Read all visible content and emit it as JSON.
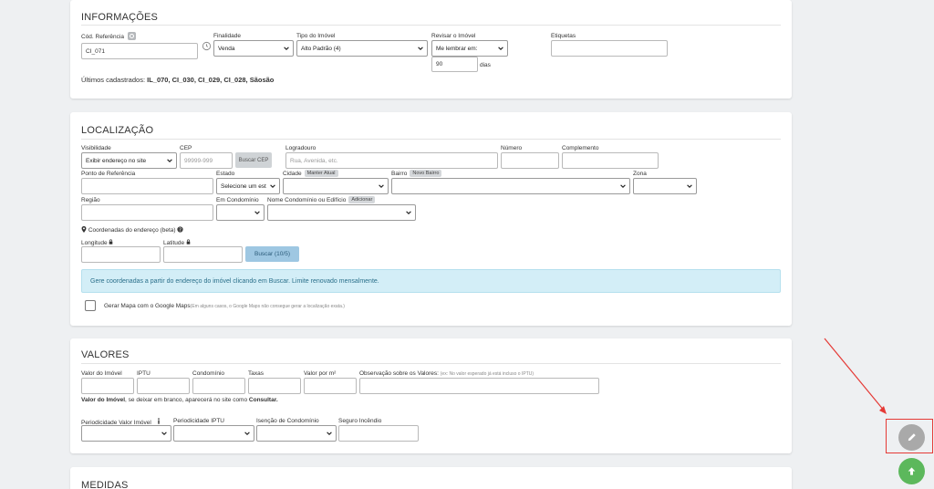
{
  "informacoes": {
    "title": "INFORMAÇÕES",
    "cod_label": "Cód. Referência",
    "cod_value": "CI_071",
    "finalidade_label": "Finalidade",
    "finalidade_value": "Venda",
    "tipo_label": "Tipo do Imóvel",
    "tipo_value": "Alto Padrão (4)",
    "revisar_label": "Revisar o Imóvel",
    "revisar_value": "Me lembrar em:",
    "dias_value": "90",
    "dias_unit": "dias",
    "etiquetas_label": "Etiquetas",
    "ultimos_prefix": "Últimos cadastrados:",
    "ultimos_value": "IL_070, CI_030, CI_029, CI_028, Sãosão"
  },
  "localizacao": {
    "title": "LOCALIZAÇÃO",
    "visibilidade_label": "Visibilidade",
    "visibilidade_value": "Exibir endereço no site",
    "cep_label": "CEP",
    "cep_placeholder": "99999-999",
    "buscar_cep": "Buscar CEP",
    "logradouro_label": "Logradouro",
    "logradouro_placeholder": "Rua, Avenida, etc.",
    "numero_label": "Número",
    "complemento_label": "Complemento",
    "ponto_label": "Ponto de Referência",
    "estado_label": "Estado",
    "estado_value": "Selecione um est",
    "cidade_label": "Cidade",
    "cidade_badge": "Manter Atual",
    "bairro_label": "Bairro",
    "bairro_badge": "Novo Bairro",
    "zona_label": "Zona",
    "regiao_label": "Região",
    "condominio_label": "Em Condomínio",
    "nome_cond_label": "Nome Condomínio ou Edifício",
    "adicionar_badge": "Adicionar",
    "coord_label": "Coordenadas do endereço (beta)",
    "longitude_label": "Longitude",
    "latitude_label": "Latitude",
    "buscar_coord": "Buscar (10/5)",
    "alert_text": "Gere coordenadas a partir do endereço do imóvel clicando em Buscar. Limite renovado mensalmente.",
    "gerar_mapa_label": "Gerar Mapa com o Google Maps",
    "gerar_mapa_note": "(Em alguns casos, o Google Maps não consegue gerar a localização exata.)"
  },
  "valores": {
    "title": "VALORES",
    "valor_imovel_label": "Valor do Imóvel",
    "iptu_label": "IPTU",
    "condominio_label": "Condomínio",
    "taxas_label": "Taxas",
    "valor_m2_label": "Valor por m²",
    "obs_label": "Observação sobre os Valores:",
    "obs_note": "(ex: No valor esperado já está incluso o IPTU)",
    "aviso_bold": "Valor do Imóvel",
    "aviso_rest": ", se deixar em branco, aparecerá no site como ",
    "aviso_bold2": "Consultar.",
    "period_valor_label": "Periodicidade Valor Imóvel",
    "period_iptu_label": "Periodicidade IPTU",
    "isencao_label": "Isenção de Condomínio",
    "seguro_label": "Seguro Incêndio"
  },
  "medidas": {
    "title": "MEDIDAS"
  },
  "colors": {
    "alert_bg": "#d3eef7",
    "fab_edit": "#a9a9a9",
    "fab_up": "#5cb85c",
    "highlight": "#e53935"
  },
  "icons": [
    "gear-icon",
    "history-icon",
    "chevron-down-icon",
    "map-marker-icon",
    "help-icon",
    "lock-icon",
    "info-icon",
    "pencil-icon",
    "arrow-up-icon"
  ]
}
